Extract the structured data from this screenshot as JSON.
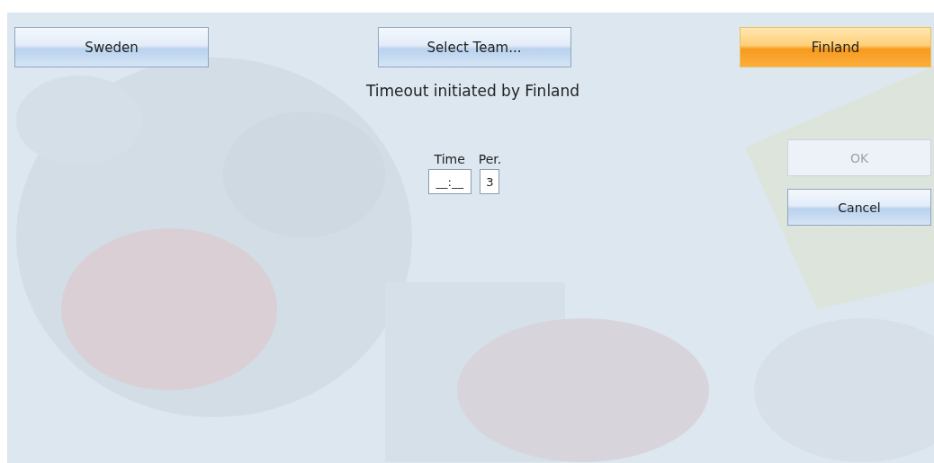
{
  "team_buttons": [
    {
      "label": "Sweden",
      "selected": false
    },
    {
      "label": "Select Team...",
      "selected": false
    },
    {
      "label": "Finland",
      "selected": true
    }
  ],
  "message": "Timeout initiated by Finland",
  "fields": [
    {
      "label": "Time",
      "value": "__:__"
    },
    {
      "label": "Per.",
      "value": "3"
    }
  ],
  "buttons": [
    {
      "label": "OK",
      "disabled": true
    },
    {
      "label": "Cancel",
      "disabled": false
    }
  ]
}
